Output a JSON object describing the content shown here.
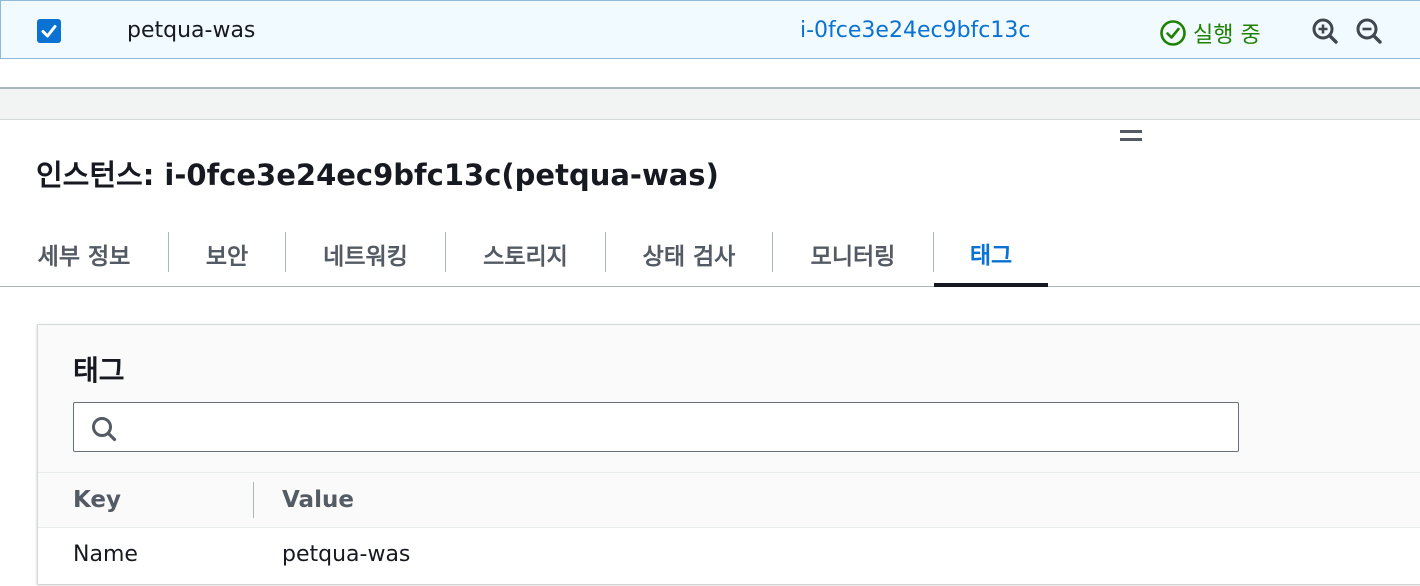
{
  "instance_row": {
    "name": "petqua-was",
    "instance_id": "i-0fce3e24ec9bfc13c",
    "state": "실행 중",
    "selected": true,
    "state_color": "#1d8102"
  },
  "panel": {
    "title": "인스턴스: i-0fce3e24ec9bfc13c(petqua-was)"
  },
  "tabs": [
    {
      "label": "세부 정보"
    },
    {
      "label": "보안"
    },
    {
      "label": "네트워킹"
    },
    {
      "label": "스토리지"
    },
    {
      "label": "상태 검사"
    },
    {
      "label": "모니터링"
    },
    {
      "label": "태그"
    }
  ],
  "active_tab": "태그",
  "tags": {
    "title": "태그",
    "search_value": "",
    "columns": [
      "Key",
      "Value"
    ],
    "rows": [
      {
        "key": "Name",
        "value": "petqua-was"
      }
    ]
  },
  "colors": {
    "accent": "#0972d3",
    "success": "#1d8102",
    "text": "#16191f",
    "muted": "#545b64"
  },
  "icons": {
    "checkbox": "checkbox-checked-icon",
    "state": "status-check-circle-icon",
    "zoom_in": "zoom-in-icon",
    "zoom_out": "zoom-out-icon",
    "splitter": "drag-handle-icon",
    "search": "search-icon"
  }
}
